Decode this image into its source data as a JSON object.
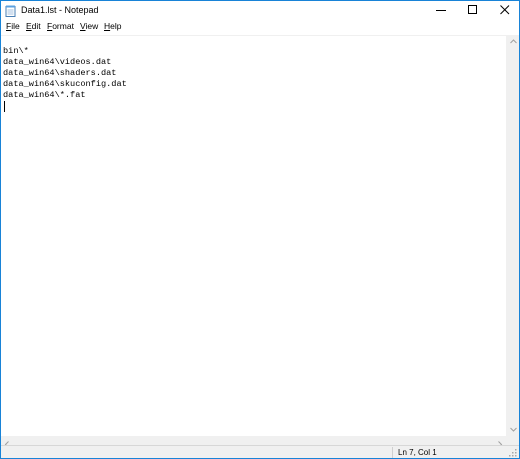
{
  "window": {
    "title": "Data1.lst - Notepad",
    "app_icon": "notepad-icon"
  },
  "caption_buttons": {
    "minimize_icon": "minimize-icon",
    "maximize_icon": "maximize-icon",
    "close_icon": "close-icon"
  },
  "menu": {
    "items": [
      {
        "mnemonic": "F",
        "rest": "ile"
      },
      {
        "mnemonic": "E",
        "rest": "dit"
      },
      {
        "mnemonic": "F",
        "rest": "ormat",
        "prefix": ""
      },
      {
        "mnemonic": "V",
        "rest": "iew"
      },
      {
        "mnemonic": "H",
        "rest": "elp"
      }
    ]
  },
  "editor": {
    "lines": [
      "",
      "bin\\*",
      "data_win64\\videos.dat",
      "data_win64\\shaders.dat",
      "data_win64\\skuconfig.dat",
      "data_win64\\*.fat",
      ""
    ]
  },
  "status": {
    "position": "Ln 7, Col 1"
  },
  "colors": {
    "accent": "#1883d7",
    "chrome": "#f0f0f0",
    "text": "#000000"
  }
}
